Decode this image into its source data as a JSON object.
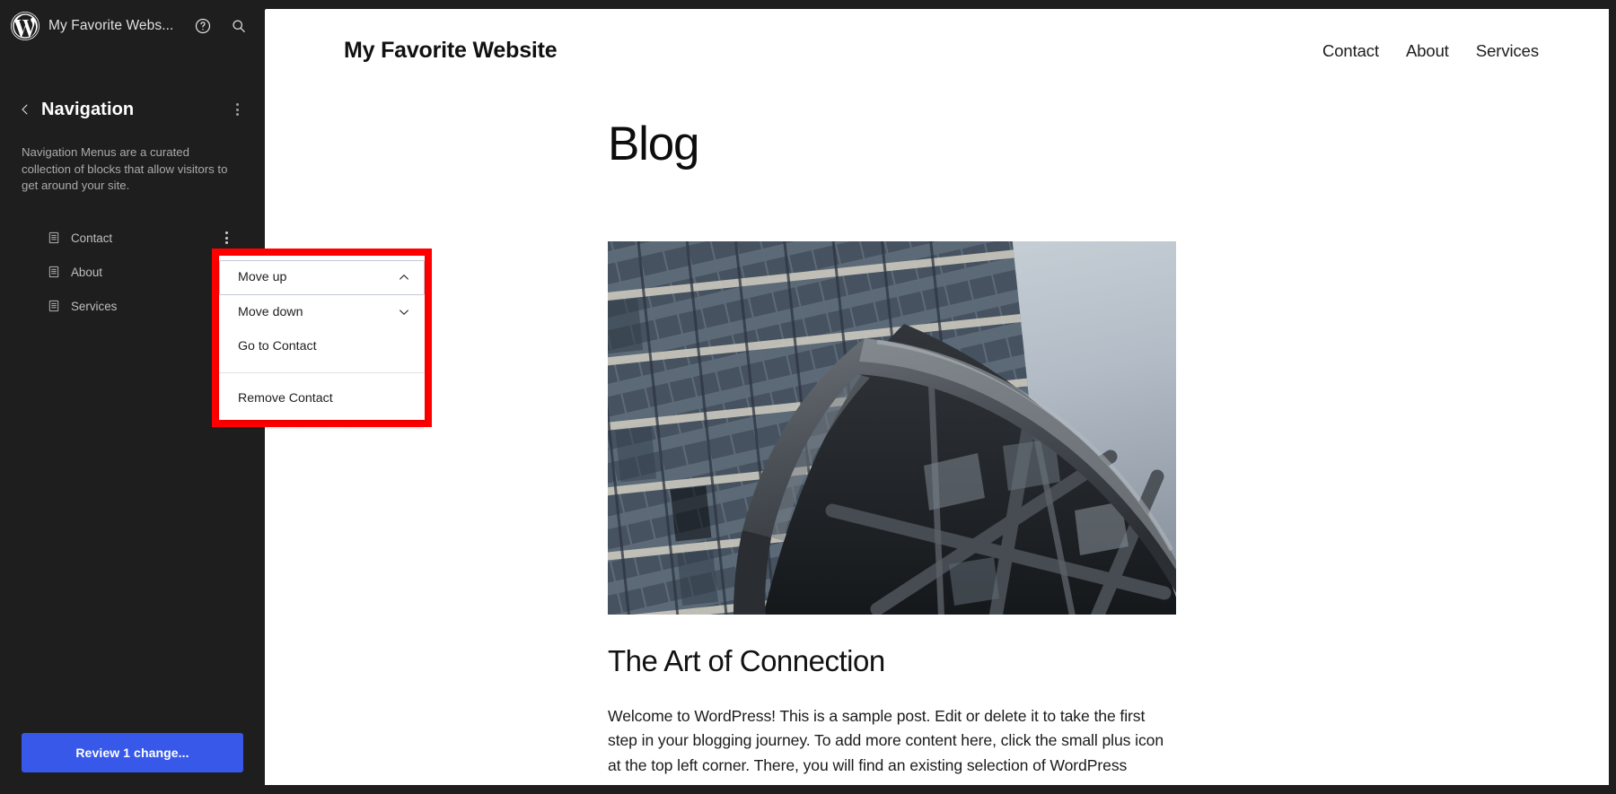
{
  "editor": {
    "site_title": "My Favorite Webs...",
    "logo_icon": "wordpress-logo-icon",
    "help_icon": "help-circle-icon",
    "search_icon": "search-icon",
    "back_icon": "chevron-left-icon",
    "kebab_icon": "more-vertical-icon"
  },
  "panel": {
    "title": "Navigation",
    "description": "Navigation Menus are a curated collection of blocks that allow visitors to get around your site.",
    "items": [
      {
        "label": "Contact",
        "icon": "page-icon"
      },
      {
        "label": "About",
        "icon": "page-icon"
      },
      {
        "label": "Services",
        "icon": "page-icon"
      }
    ]
  },
  "footer": {
    "review_label": "Review 1 change...",
    "accent_color": "#3858e9"
  },
  "dropdown": {
    "highlight_color": "#ff0000",
    "items": [
      {
        "label": "Move up",
        "icon": "chevron-up-icon",
        "focused": true
      },
      {
        "label": "Move down",
        "icon": "chevron-down-icon",
        "focused": false
      },
      {
        "label": "Go to Contact",
        "icon": "",
        "focused": false
      },
      {
        "label": "Remove Contact",
        "icon": "",
        "focused": false
      }
    ]
  },
  "site": {
    "name": "My Favorite Website",
    "nav": [
      {
        "label": "Contact"
      },
      {
        "label": "About"
      },
      {
        "label": "Services"
      }
    ],
    "page_heading": "Blog",
    "post": {
      "image_alt": "building-photo",
      "title": "The Art of Connection",
      "body": "Welcome to WordPress! This is a sample post. Edit or delete it to take the first step in your blogging journey. To add more content here, click the small plus icon at the top left corner. There, you will find an existing selection of WordPress"
    }
  }
}
